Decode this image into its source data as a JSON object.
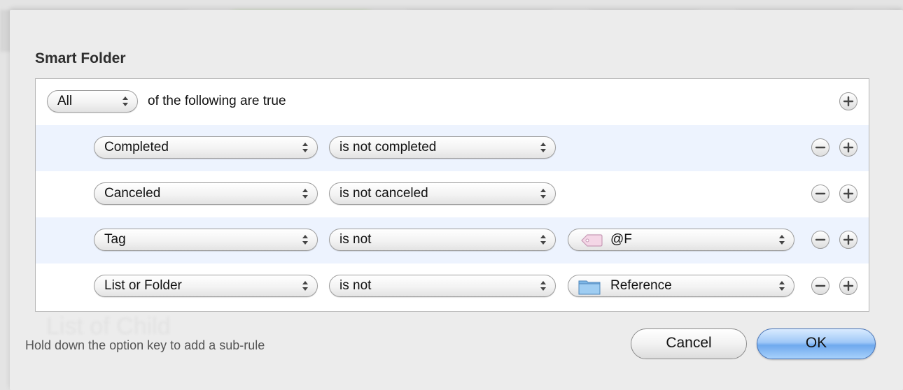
{
  "dialog": {
    "title": "Smart Folder",
    "hint": "Hold down the option key to add a sub-rule",
    "cancel_label": "Cancel",
    "ok_label": "OK"
  },
  "match": {
    "selected": "All",
    "text": "of the following are true"
  },
  "rules": [
    {
      "field": "Completed",
      "operator": "is not completed",
      "value": null
    },
    {
      "field": "Canceled",
      "operator": "is not canceled",
      "value": null
    },
    {
      "field": "Tag",
      "operator": "is not",
      "value": "@F",
      "value_icon": "tag-icon"
    },
    {
      "field": "List or Folder",
      "operator": "is not",
      "value": "Reference",
      "value_icon": "folder-icon"
    }
  ],
  "colors": {
    "alt_row": "#edf3fe",
    "ok_button": "#7fb2f0"
  }
}
